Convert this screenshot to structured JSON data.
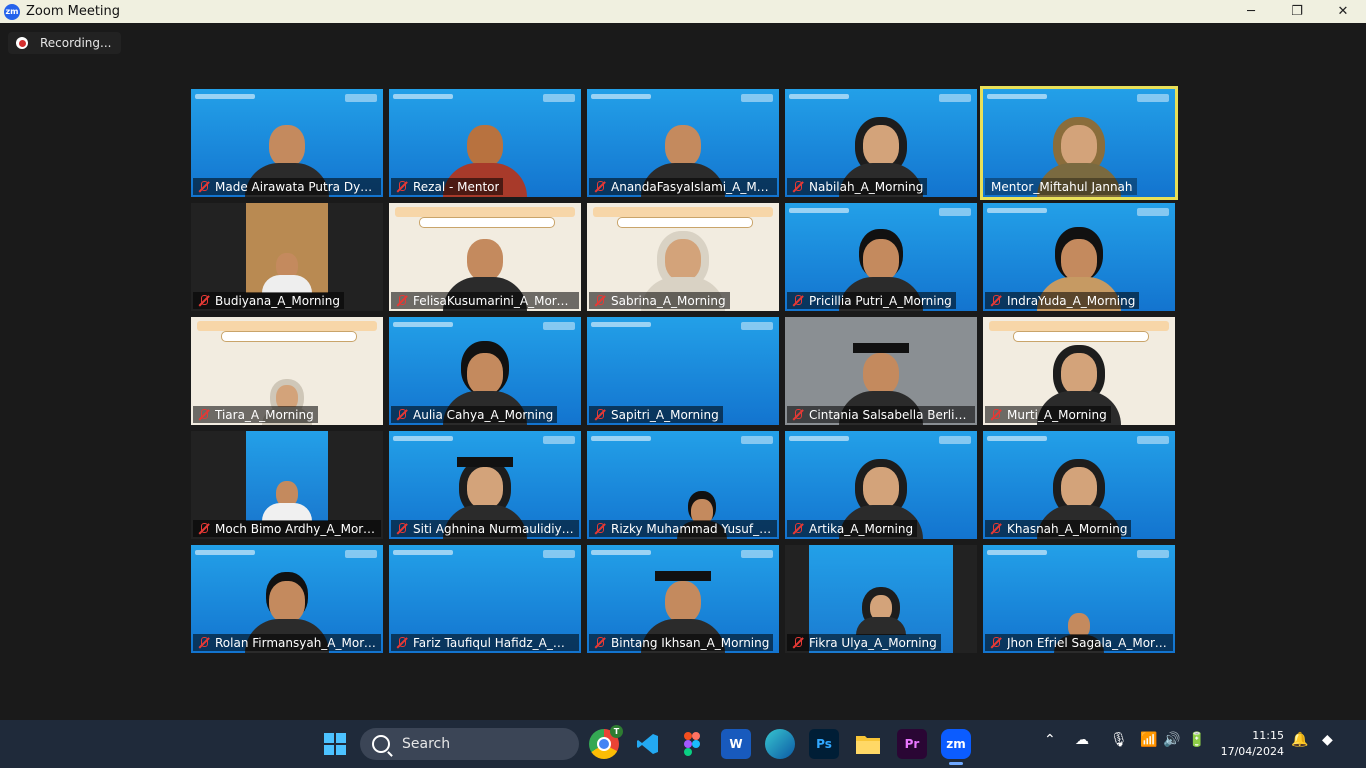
{
  "window": {
    "title": "Zoom Meeting",
    "logo_text": "zm"
  },
  "controls": {
    "minimize": "─",
    "restore": "❐",
    "close": "✕"
  },
  "recording": {
    "label": "Recording..."
  },
  "participants": [
    {
      "name": "Made Airawata Putra Dyat..."
    },
    {
      "name": "Rezal - Mentor"
    },
    {
      "name": "AnandaFasyaIslami_A_Mor..."
    },
    {
      "name": "Nabilah_A_Morning"
    },
    {
      "name": "Mentor_Miftahul Jannah"
    },
    {
      "name": "Budiyana_A_Morning"
    },
    {
      "name": "FelisaKusumarini_A_Morning"
    },
    {
      "name": "Sabrina_A_Morning"
    },
    {
      "name": "Pricillia Putri_A_Morning"
    },
    {
      "name": "IndraYuda_A_Morning"
    },
    {
      "name": "Tiara_A_Morning"
    },
    {
      "name": "Aulia Cahya_A_Morning"
    },
    {
      "name": "Sapitri_A_Morning"
    },
    {
      "name": "Cintania Salsabella Berliant..."
    },
    {
      "name": "Murti_A_Morning"
    },
    {
      "name": "Moch Bimo Ardhy_A_Morni..."
    },
    {
      "name": "Siti Aghnina Nurmaulidiyah..."
    },
    {
      "name": "Rizky Muhammad Yusuf_A_..."
    },
    {
      "name": "Artika_A_Morning"
    },
    {
      "name": "Khasnah_A_Morning"
    },
    {
      "name": "Rolan Firmansyah_A_Morni..."
    },
    {
      "name": "Fariz Taufiqul Hafidz_A_Mo..."
    },
    {
      "name": "Bintang Ikhsan_A_Morning"
    },
    {
      "name": "Fikra Ulya_A_Morning"
    },
    {
      "name": "Jhon Efriel Sagala_A_Morni..."
    }
  ],
  "taskbar": {
    "search_label": "Search",
    "apps": [
      "Chrome",
      "VS Code",
      "Figma",
      "Word",
      "Edge",
      "Photoshop",
      "File Explorer",
      "Premiere Pro",
      "Zoom"
    ],
    "app_texts": {
      "word": "W",
      "ps": "Ps",
      "pr": "Pr",
      "zoom": "zm",
      "badge": "T"
    },
    "time": "11:15",
    "date": "17/04/2024"
  }
}
